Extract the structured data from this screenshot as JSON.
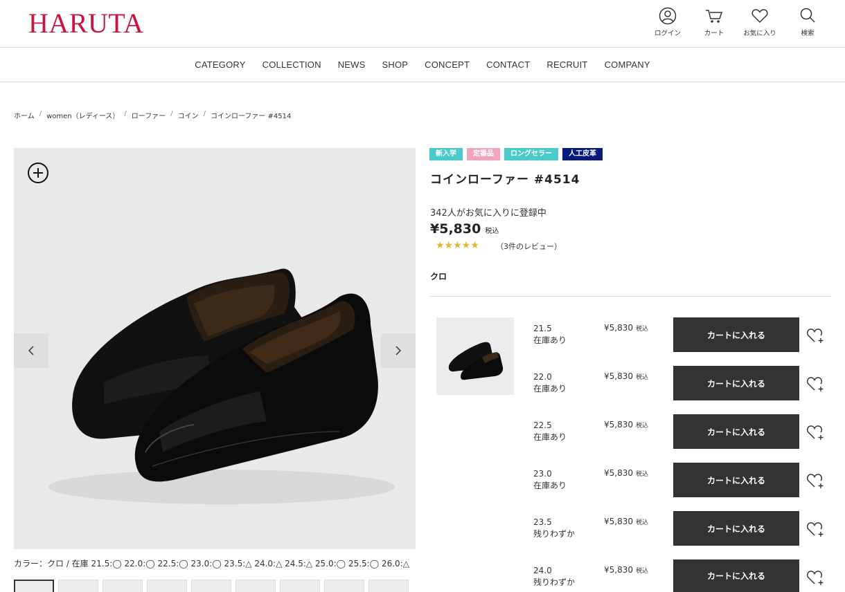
{
  "header": {
    "logo": "HARUTA",
    "icons": [
      {
        "name": "user-icon",
        "label": "ログイン"
      },
      {
        "name": "cart-icon",
        "label": "カート"
      },
      {
        "name": "heart-icon",
        "label": "お気に入り"
      },
      {
        "name": "search-icon",
        "label": "検索"
      }
    ],
    "brand_color": "#c8143c"
  },
  "nav": [
    "CATEGORY",
    "COLLECTION",
    "NEWS",
    "SHOP",
    "CONCEPT",
    "CONTACT",
    "RECRUIT",
    "COMPANY"
  ],
  "breadcrumb": [
    "ホーム",
    "women（レディース）",
    "ローファー",
    "コイン",
    "コインローファー #4514"
  ],
  "gallery": {
    "caption": "カラー：クロ  /  在庫 21.5:◯  22.0:◯  22.5:◯  23.0:◯  23.5:△  24.0:△  24.5:△  25.0:◯  25.5:◯  26.0:△"
  },
  "product": {
    "tags": [
      {
        "label": "新入学",
        "color": "#4cc9c9"
      },
      {
        "label": "定番品",
        "color": "#f3a4bd"
      },
      {
        "label": "ロングセラー",
        "color": "#4cc9c9"
      },
      {
        "label": "人工皮革",
        "color": "#0a1a7a"
      }
    ],
    "title": "コインローファー #4514",
    "favorites": "342人がお気に入りに登録中",
    "price": "¥5,830",
    "tax_label": "税込",
    "rating": 5,
    "stars": "★★★★★",
    "reviews": "（3件のレビュー）",
    "color_name": "クロ"
  },
  "skus": [
    {
      "size": "21.5",
      "stock": "在庫あり",
      "price": "¥5,830",
      "tax": "税込",
      "button": "カートに入れる"
    },
    {
      "size": "22.0",
      "stock": "在庫あり",
      "price": "¥5,830",
      "tax": "税込",
      "button": "カートに入れる"
    },
    {
      "size": "22.5",
      "stock": "在庫あり",
      "price": "¥5,830",
      "tax": "税込",
      "button": "カートに入れる"
    },
    {
      "size": "23.0",
      "stock": "在庫あり",
      "price": "¥5,830",
      "tax": "税込",
      "button": "カートに入れる"
    },
    {
      "size": "23.5",
      "stock": "残りわずか",
      "price": "¥5,830",
      "tax": "税込",
      "button": "カートに入れる"
    },
    {
      "size": "24.0",
      "stock": "残りわずか",
      "price": "¥5,830",
      "tax": "税込",
      "button": "カートに入れる"
    }
  ]
}
